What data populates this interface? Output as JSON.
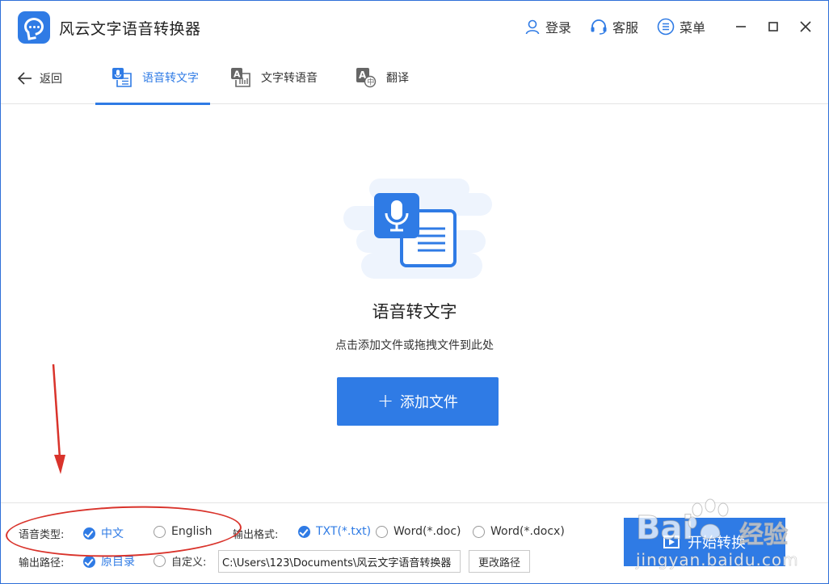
{
  "titlebar": {
    "app_title": "风云文字语音转换器",
    "login_label": "登录",
    "support_label": "客服",
    "menu_label": "菜单"
  },
  "nav": {
    "back_label": "返回",
    "tabs": [
      {
        "label": "语音转文字",
        "active": true
      },
      {
        "label": "文字转语音",
        "active": false
      },
      {
        "label": "翻译",
        "active": false
      }
    ]
  },
  "main": {
    "title": "语音转文字",
    "hint": "点击添加文件或拖拽文件到此处",
    "add_button_label": "添加文件"
  },
  "options": {
    "voice_type_label": "语音类型:",
    "voice_types": [
      {
        "label": "中文",
        "checked": true
      },
      {
        "label": "English",
        "checked": false
      }
    ],
    "output_format_label": "输出格式:",
    "output_formats": [
      {
        "label": "TXT(*.txt)",
        "checked": true
      },
      {
        "label": "Word(*.doc)",
        "checked": false
      },
      {
        "label": "Word(*.docx)",
        "checked": false
      }
    ],
    "output_path_label": "输出路径:",
    "output_paths": [
      {
        "label": "原目录",
        "checked": true
      },
      {
        "label": "自定义:",
        "checked": false
      }
    ],
    "path_value": "C:\\Users\\123\\Documents\\风云文字语音转换器",
    "change_path_label": "更改路径",
    "start_button_label": "开始转换"
  },
  "watermark": {
    "logo": "Bai",
    "logo_cn": "经验",
    "url": "jingyan.baidu.com"
  },
  "colors": {
    "accent": "#2f7be5",
    "annotation": "#d9332b"
  }
}
